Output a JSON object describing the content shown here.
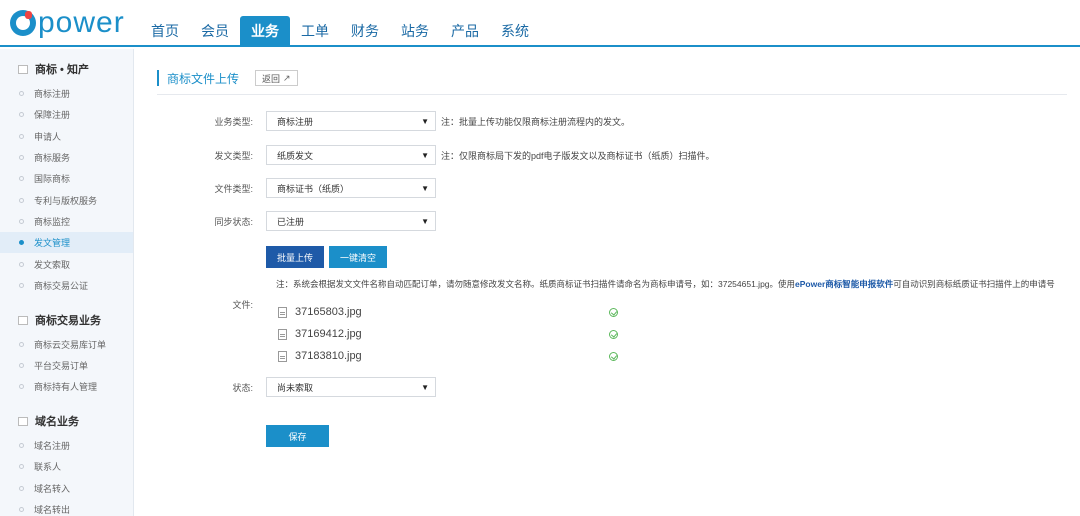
{
  "logo": {
    "text": "power"
  },
  "nav": {
    "items": [
      {
        "label": "首页"
      },
      {
        "label": "会员"
      },
      {
        "label": "业务"
      },
      {
        "label": "工单"
      },
      {
        "label": "财务"
      },
      {
        "label": "站务"
      },
      {
        "label": "产品"
      },
      {
        "label": "系统"
      }
    ],
    "active_index": 2
  },
  "sidebar": {
    "groups": [
      {
        "title": "商标 • 知产",
        "items": [
          "商标注册",
          "保障注册",
          "申请人",
          "商标服务",
          "国际商标",
          "专利与版权服务",
          "商标监控",
          "发文管理",
          "发文索取",
          "商标交易公证"
        ]
      },
      {
        "title": "商标交易业务",
        "items": [
          "商标云交易库订单",
          "平台交易订单",
          "商标持有人管理"
        ]
      },
      {
        "title": "域名业务",
        "items": [
          "域名注册",
          "联系人",
          "域名转入",
          "域名转出"
        ]
      }
    ],
    "active_item": "发文管理"
  },
  "page": {
    "title": "商标文件上传",
    "back_label": "返回"
  },
  "form": {
    "business_type": {
      "label": "业务类型:",
      "value": "商标注册",
      "note": "注：批量上传功能仅限商标注册流程内的发文。"
    },
    "doc_type": {
      "label": "发文类型:",
      "value": "纸质发文",
      "note": "注：仅限商标局下发的pdf电子版发文以及商标证书（纸质）扫描件。"
    },
    "file_type": {
      "label": "文件类型:",
      "value": "商标证书（纸质）"
    },
    "sync_status": {
      "label": "同步状态:",
      "value": "已注册"
    },
    "batch_upload_label": "批量上传",
    "clear_label": "一键清空",
    "file_note_prefix": "注：系统会根据发文文件名称自动匹配订单，请勿随意修改发文名称。纸质商标证书扫描件请命名为商标申请号，如：37254651.jpg。使用",
    "file_note_link": "ePower商标智能申报软件",
    "file_note_suffix": "可自动识别商标纸质证书扫描件上的申请号",
    "files_label": "文件:",
    "files": [
      {
        "name": "37165803.jpg",
        "status": "uploaded"
      },
      {
        "name": "37169412.jpg",
        "status": "uploaded"
      },
      {
        "name": "37183810.jpg",
        "status": "uploaded"
      }
    ],
    "status": {
      "label": "状态:",
      "value": "尚未索取"
    },
    "save_label": "保存"
  },
  "colors": {
    "accent": "#1b8fc9",
    "primary_dark": "#1e5aa8",
    "success": "#5cb85c"
  }
}
